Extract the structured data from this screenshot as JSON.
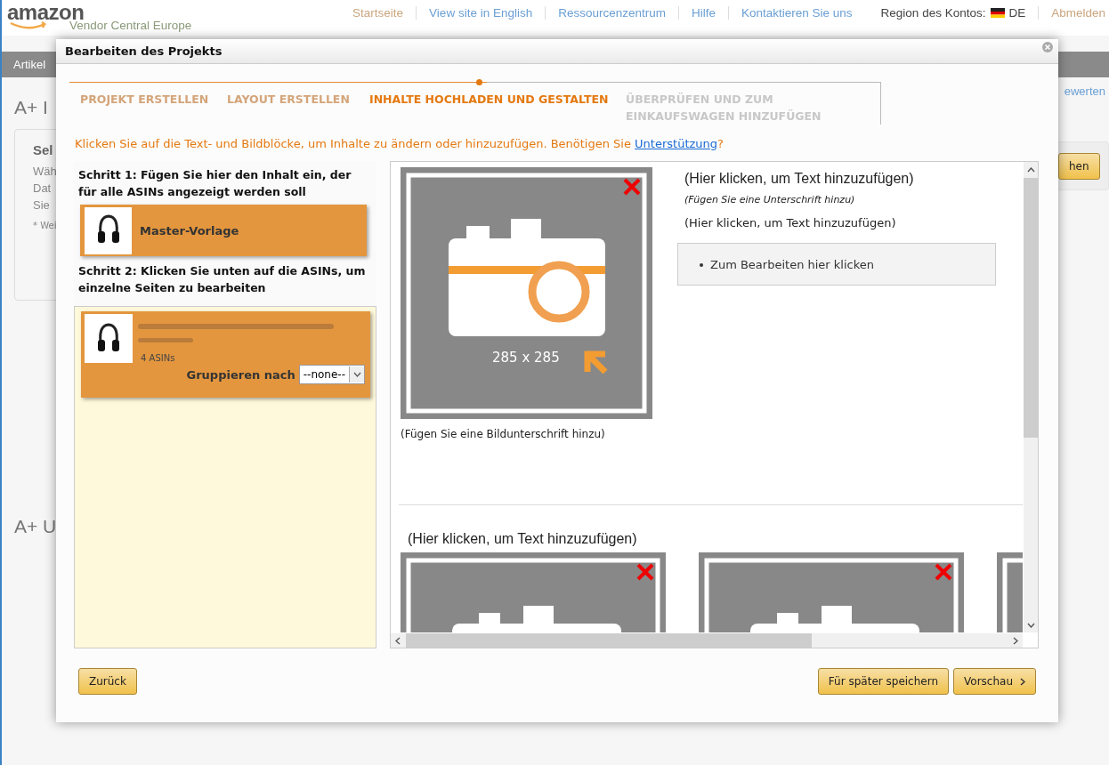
{
  "header": {
    "brand": "amazon",
    "subtitle": "Vendor Central Europe",
    "nav": [
      {
        "label": "Startseite",
        "selected": true
      },
      {
        "label": "View site in English",
        "selected": false
      },
      {
        "label": "Ressourcenzentrum",
        "selected": false
      },
      {
        "label": "Hilfe",
        "selected": false
      },
      {
        "label": "Kontaktieren Sie uns",
        "selected": false
      }
    ],
    "region_label": "Region des Kontos:",
    "region_code": "DE",
    "logout": "Abmelden"
  },
  "background_page": {
    "tab": "Artikel",
    "heading_1": "A+ I",
    "card_title": "Sel",
    "card_lines": [
      "Wäh",
      "Dat",
      "Sie"
    ],
    "card_note": "* Wei",
    "link": "ewerten",
    "button": "hen",
    "heading_2": "A+ U"
  },
  "modal": {
    "title": "Bearbeiten des Projekts",
    "steps": [
      {
        "label": "PROJEKT ERSTELLEN",
        "completed": true,
        "selected": false
      },
      {
        "label": "LAYOUT ERSTELLEN",
        "completed": true,
        "selected": false
      },
      {
        "label": "INHALTE HOCHLADEN UND GESTALTEN",
        "completed": false,
        "selected": true
      },
      {
        "label": "ÜBERPRÜFEN UND ZUM EINKAUFSWAGEN HINZUFÜGEN",
        "completed": false,
        "selected": false
      }
    ],
    "instruction": "Klicken Sie auf die Text- und Bildblöcke, um Inhalte zu ändern oder hinzuzufügen. Benötigen Sie",
    "instruction_link": "Unterstützung",
    "instruction_end": "?",
    "step1": "Schritt 1: Fügen Sie hier den Inhalt ein, der für alle ASINs angezeigt werden soll",
    "master": "Master-Vorlage",
    "step2": "Schritt 2: Klicken Sie unten auf die ASINs, um einzelne Seiten zu bearbeiten",
    "asin_group": {
      "count": "4 ASINs",
      "group_label": "Gruppieren nach",
      "group_value": "--none--"
    },
    "module_1": {
      "image_size": "285 x 285",
      "heading": "(Hier klicken, um Text hinzuzufügen)",
      "subheading": "(Fügen Sie eine Unterschrift hinzu)",
      "body": "(Hier klicken, um Text hinzuzufügen)",
      "bullets": [
        "Zum Bearbeiten hier klicken"
      ],
      "caption": "(Fügen Sie eine Bildunterschrift hinzu)"
    },
    "module_2": {
      "heading": "(Hier klicken, um Text hinzuzufügen)",
      "images": [
        {
          "kind": "placeholder"
        },
        {
          "kind": "placeholder"
        },
        {
          "kind": "partial"
        }
      ]
    },
    "buttons_left": [
      "Zurück"
    ],
    "buttons_right": [
      {
        "label": "Für später speichern",
        "arrow": false
      },
      {
        "label": "Vorschau",
        "arrow": true
      }
    ]
  }
}
